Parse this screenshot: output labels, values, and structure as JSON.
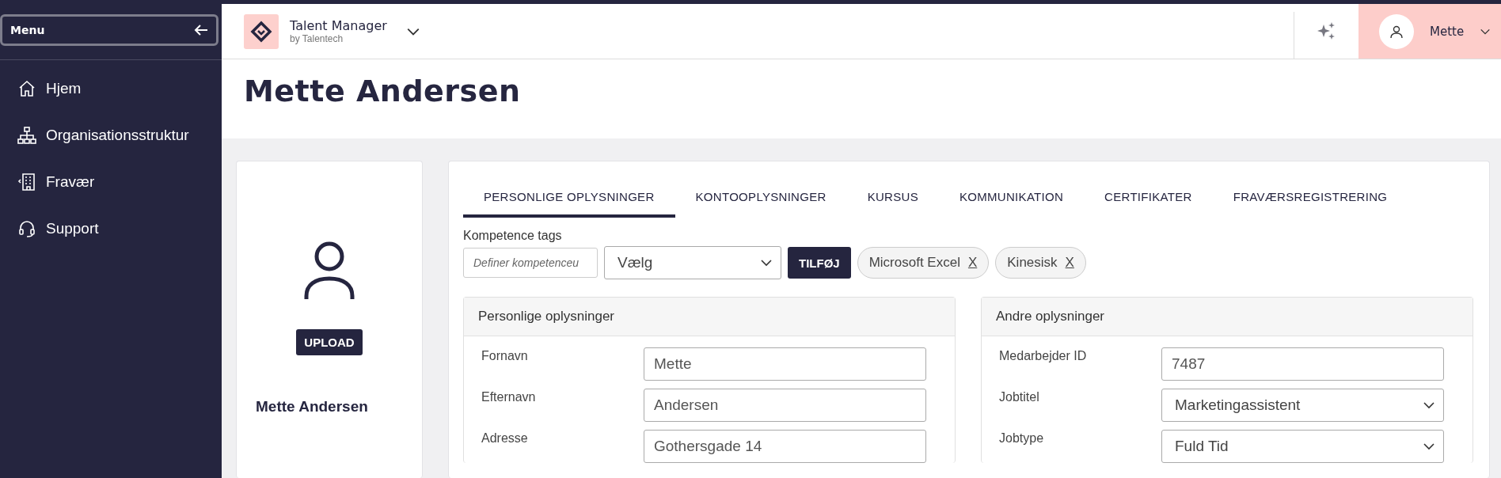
{
  "sidebar": {
    "menu_button": "Menu",
    "items": [
      {
        "label": "Hjem",
        "kind": "home"
      },
      {
        "label": "Organisationsstruktur",
        "kind": "org"
      },
      {
        "label": "Fravær",
        "kind": "building"
      },
      {
        "label": "Support",
        "kind": "headset"
      }
    ]
  },
  "topbar": {
    "app_name": "Talent Manager",
    "app_vendor": "by Talentech",
    "user_name": "Mette"
  },
  "page_title": "Mette Andersen",
  "profile_card": {
    "upload_button": "UPLOAD",
    "name": "Mette Andersen"
  },
  "tabs": [
    {
      "label": "PERSONLIGE OPLYSNINGER",
      "selected": true
    },
    {
      "label": "KONTOOPLYSNINGER",
      "selected": false
    },
    {
      "label": "KURSUS",
      "selected": false
    },
    {
      "label": "KOMMUNIKATION",
      "selected": false
    },
    {
      "label": "CERTIFIKATER",
      "selected": false
    },
    {
      "label": "FRAVÆRSREGISTRERING",
      "selected": false
    }
  ],
  "competence": {
    "label": "Kompetence tags",
    "placeholder": "Definer kompetenceu",
    "select_value": "Vælg",
    "add_button": "TILFØJ",
    "tags": [
      {
        "label": "Microsoft Excel",
        "remove": "X"
      },
      {
        "label": "Kinesisk",
        "remove": "X"
      }
    ]
  },
  "panels": [
    {
      "title": "Personlige oplysninger",
      "fields": [
        {
          "label": "Fornavn",
          "value": "Mette",
          "kind": "text"
        },
        {
          "label": "Efternavn",
          "value": "Andersen",
          "kind": "text"
        },
        {
          "label": "Adresse",
          "value": "Gothersgade 14",
          "kind": "text"
        }
      ]
    },
    {
      "title": "Andre oplysninger",
      "fields": [
        {
          "label": "Medarbejder ID",
          "value": "7487",
          "kind": "text"
        },
        {
          "label": "Jobtitel",
          "value": "Marketingassistent",
          "kind": "select"
        },
        {
          "label": "Jobtype",
          "value": "Fuld Tid",
          "kind": "select"
        }
      ]
    }
  ]
}
